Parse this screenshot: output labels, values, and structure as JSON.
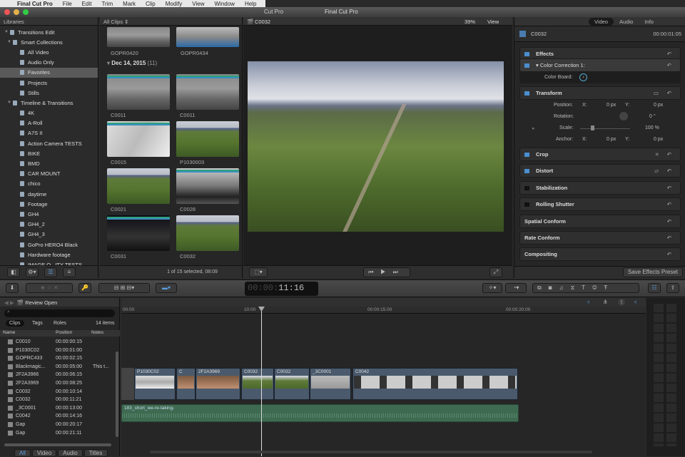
{
  "menu": {
    "apple": "",
    "app": "Final Cut Pro",
    "items": [
      "File",
      "Edit",
      "Trim",
      "Mark",
      "Clip",
      "Modify",
      "View",
      "Window",
      "Help"
    ]
  },
  "window": {
    "title": "Final Cut Pro",
    "title_fragment": "Cut Pro"
  },
  "libraries": {
    "header": "Libraries",
    "items": [
      {
        "label": "Transitions Edit",
        "level": 0
      },
      {
        "label": "Smart Collections",
        "level": 1
      },
      {
        "label": "All Video",
        "level": 2
      },
      {
        "label": "Audio Only",
        "level": 2
      },
      {
        "label": "Favorites",
        "level": 2,
        "selected": true
      },
      {
        "label": "Projects",
        "level": 2
      },
      {
        "label": "Stills",
        "level": 2
      },
      {
        "label": "Timeline & Transitions",
        "level": 1
      },
      {
        "label": "4K",
        "level": 2
      },
      {
        "label": "A-Roll",
        "level": 2
      },
      {
        "label": "A7S II",
        "level": 2
      },
      {
        "label": "Action Camera TESTS",
        "level": 2
      },
      {
        "label": "BIKE",
        "level": 2
      },
      {
        "label": "BMD",
        "level": 2
      },
      {
        "label": "CAR MOUNT",
        "level": 2
      },
      {
        "label": "chico",
        "level": 2
      },
      {
        "label": "daytime",
        "level": 2
      },
      {
        "label": "Footage",
        "level": 2
      },
      {
        "label": "GH4",
        "level": 2
      },
      {
        "label": "GH4_2",
        "level": 2
      },
      {
        "label": "GH4_3",
        "level": 2
      },
      {
        "label": "GoPro HERO4 Black",
        "level": 2
      },
      {
        "label": "Hardware footage",
        "level": 2
      },
      {
        "label": "IMAGE Q...ITY TESTS",
        "level": 2
      }
    ]
  },
  "browser": {
    "filter": "All Clips ⇕",
    "group_date": "Dec 14, 2015",
    "group_count": "(11)",
    "top_clips": [
      "GOPR0420",
      "GOPR0434"
    ],
    "clips": [
      "C0011",
      "C0011",
      "C0015",
      "P1030003",
      "C0021",
      "C0028",
      "C0031",
      "C0032"
    ],
    "status": "1 of 15 selected, 08:09"
  },
  "viewer": {
    "clip_name": "C0032",
    "zoom": "39%",
    "view_menu": "View"
  },
  "inspector": {
    "tabs": [
      "Video",
      "Audio",
      "Info"
    ],
    "clip_name": "C0032",
    "duration": "00:00:01:05",
    "effects": "Effects",
    "color_correction": "Color Correction 1:",
    "color_board": "Color Board:",
    "transform": "Transform",
    "position_label": "Position:",
    "rotation_label": "Rotation:",
    "scale_label": "Scale:",
    "anchor_label": "Anchor:",
    "x": "X:",
    "y": "Y:",
    "zero_px": "0 px",
    "rotation_value": "0 °",
    "scale_value": "100 %",
    "sections": [
      "Crop",
      "Distort",
      "Stabilization",
      "Rolling Shutter",
      "Spatial Conform",
      "Rate Conform",
      "Compositing"
    ],
    "save_preset": "Save Effects Preset"
  },
  "toolbar": {
    "timecode_dim": "00:00:",
    "timecode": "11:16"
  },
  "index": {
    "project": "Review Open",
    "tabs": [
      "Clips",
      "Tags",
      "Roles"
    ],
    "count": "14 items",
    "columns": [
      "Name",
      "Position",
      "Notes"
    ],
    "rows": [
      [
        "C0010",
        "00:00:00:15",
        ""
      ],
      [
        "P1030C02",
        "00:00:01:00",
        ""
      ],
      [
        "GOPRC433",
        "00:00:02:15",
        ""
      ],
      [
        "Blackmagic...",
        "00:00:05:00",
        "This t..."
      ],
      [
        "2F2A3966",
        "00:00:06:15",
        ""
      ],
      [
        "2F2A3969",
        "00:00:08:25",
        ""
      ],
      [
        "C0032",
        "00:00:10:14",
        ""
      ],
      [
        "C0032",
        "00:00:11:21",
        ""
      ],
      [
        "_3C0001",
        "00:00:13:00",
        ""
      ],
      [
        "C0042",
        "00:00:14:16",
        ""
      ],
      [
        "Gap",
        "00:00:20:17",
        ""
      ],
      [
        "Gap",
        "00:00:21:11",
        ""
      ]
    ],
    "bottom_tabs": [
      "All",
      "Video",
      "Audio",
      "Titles"
    ]
  },
  "timeline": {
    "ruler": [
      "00:00",
      "10:00",
      "00:00:15:00",
      "00:00:20:00"
    ],
    "clips": [
      "P1030C02",
      "C",
      "2F2A3969",
      "C0032",
      "C0032",
      "_3C0001",
      "C0042"
    ],
    "audio_clip": "183_short_we-re-taking-"
  }
}
